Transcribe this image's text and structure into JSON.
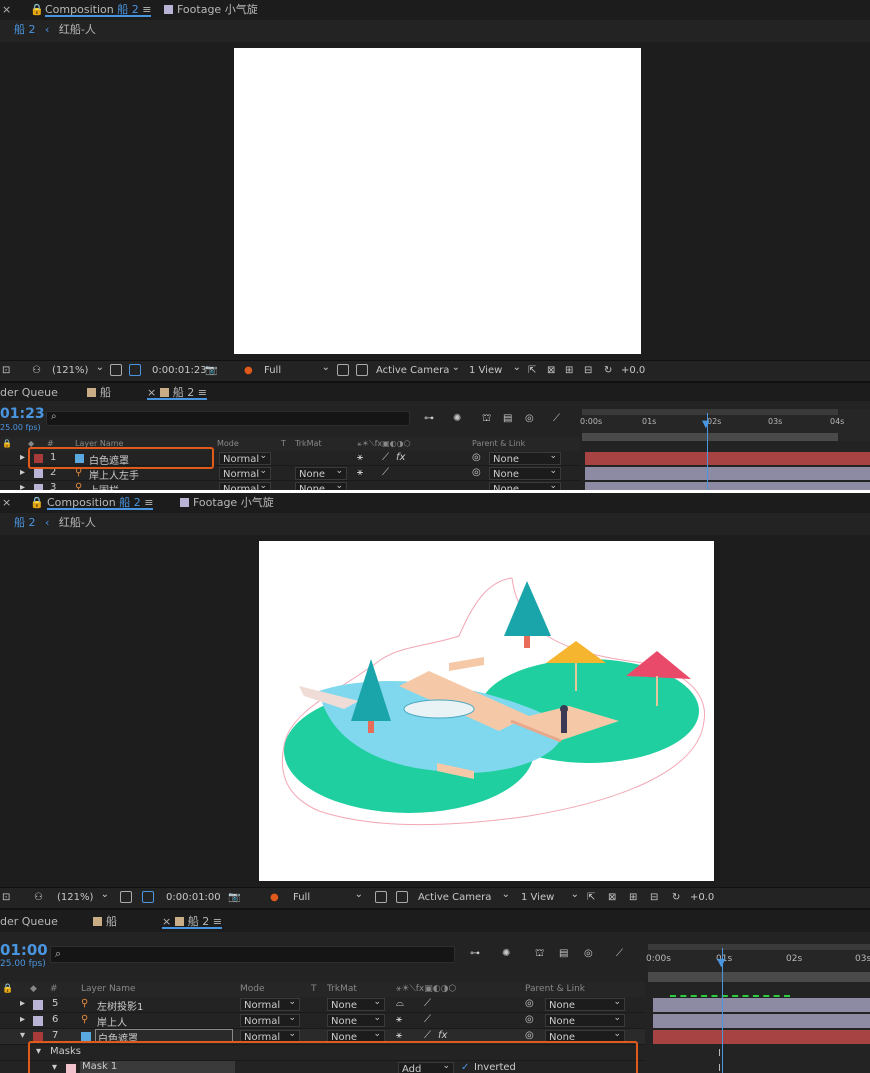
{
  "top": {
    "tabs": {
      "composition": "Composition",
      "comp_name": "船 2",
      "footage": "Footage 小气旋"
    },
    "breadcrumb": [
      "船 2",
      "红船-人"
    ],
    "viewer_toolbar": {
      "zoom": "(121%)",
      "timecode": "0:00:01:23",
      "resolution": "Full",
      "camera": "Active Camera",
      "view": "1 View",
      "exposure": "+0.0"
    },
    "timeline_tabs": {
      "render_queue": "der Queue",
      "comp1": "船",
      "comp2": "船 2"
    },
    "current_time": "01:23",
    "fps": "25.00 fps)",
    "columns": {
      "num": "#",
      "layer_name": "Layer Name",
      "mode": "Mode",
      "t": "T",
      "trkmat": "TrkMat",
      "parent": "Parent & Link"
    },
    "ruler": [
      "0:00s",
      "01s",
      "02s",
      "03s",
      "04s"
    ],
    "layers": [
      {
        "num": "1",
        "name": "白色遮罩",
        "mode": "Normal",
        "trkmat": "",
        "parent": "None"
      },
      {
        "num": "2",
        "name": "岸上人左手",
        "mode": "Normal",
        "trkmat": "None",
        "parent": "None"
      },
      {
        "num": "3",
        "name": "上围栏",
        "mode": "Normal",
        "trkmat": "None",
        "parent": "None"
      }
    ]
  },
  "bottom": {
    "tabs": {
      "composition": "Composition",
      "comp_name": "船 2",
      "footage": "Footage 小气旋"
    },
    "breadcrumb": [
      "船 2",
      "红船-人"
    ],
    "viewer_toolbar": {
      "zoom": "(121%)",
      "timecode": "0:00:01:00",
      "resolution": "Full",
      "camera": "Active Camera",
      "view": "1 View",
      "exposure": "+0.0"
    },
    "timeline_tabs": {
      "render_queue": "der Queue",
      "comp1": "船",
      "comp2": "船 2"
    },
    "current_time": "01:00",
    "fps": "25.00 fps)",
    "columns": {
      "num": "#",
      "layer_name": "Layer Name",
      "mode": "Mode",
      "t": "T",
      "trkmat": "TrkMat",
      "parent": "Parent & Link"
    },
    "ruler": [
      "0:00s",
      "01s",
      "02s",
      "03s"
    ],
    "layers": [
      {
        "num": "5",
        "name": "左树投影1",
        "mode": "Normal",
        "trkmat": "None",
        "parent": "None"
      },
      {
        "num": "6",
        "name": "岸上人",
        "mode": "Normal",
        "trkmat": "None",
        "parent": "None"
      },
      {
        "num": "7",
        "name": "白色遮罩",
        "mode": "Normal",
        "trkmat": "None",
        "parent": "None"
      }
    ],
    "masks_label": "Masks",
    "mask": {
      "name": "Mask 1",
      "mode": "Add",
      "inverted": "Inverted"
    }
  },
  "colors": {
    "accent": "#4a95e0",
    "highlight": "#e05a1c",
    "layer_red": "#a83a3a",
    "layer_lavender": "#b9b3d6"
  }
}
